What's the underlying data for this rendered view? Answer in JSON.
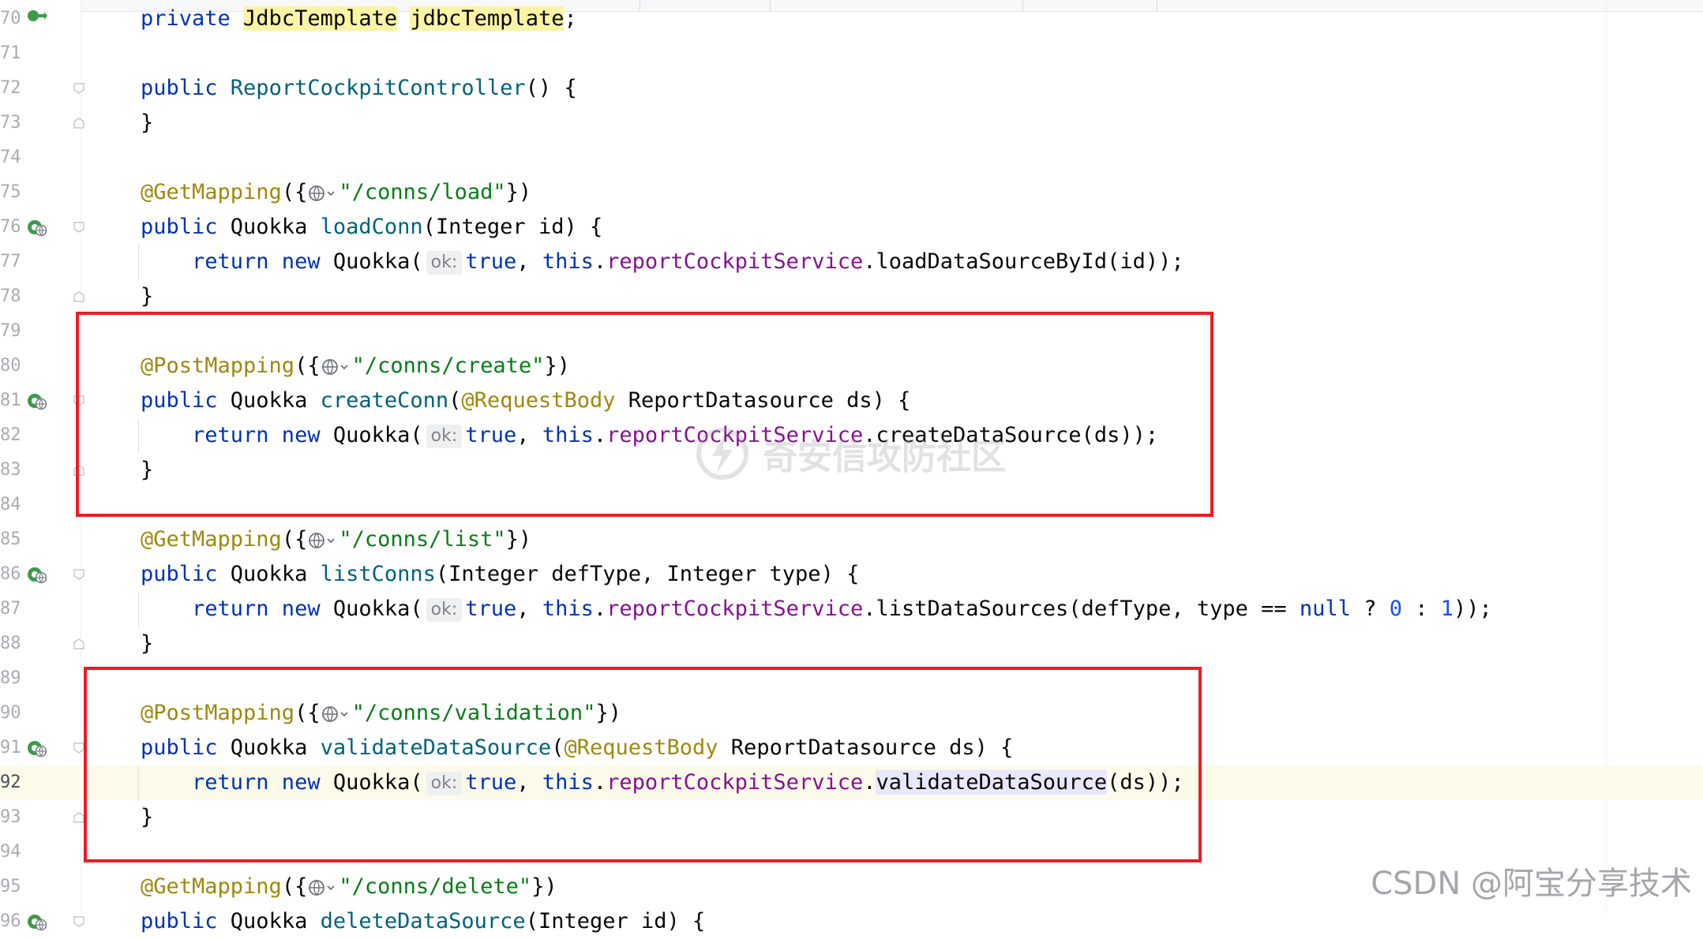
{
  "editor": {
    "lines": [
      {
        "num": "70",
        "icon": "override",
        "fold": "",
        "tokens": [
          {
            "t": "private ",
            "c": "kw"
          },
          {
            "t": "JdbcTemplate",
            "c": "hl"
          },
          {
            "t": " "
          },
          {
            "t": "jdbcTemplate",
            "c": "hl"
          },
          {
            "t": ";"
          }
        ]
      },
      {
        "num": "71",
        "icon": "",
        "fold": "",
        "tokens": []
      },
      {
        "num": "72",
        "icon": "",
        "fold": "open",
        "tokens": [
          {
            "t": "public ",
            "c": "kw"
          },
          {
            "t": "ReportCockpitController",
            "c": "fn"
          },
          {
            "t": "() {"
          }
        ]
      },
      {
        "num": "73",
        "icon": "",
        "fold": "close",
        "tokens": [
          {
            "t": "}"
          }
        ]
      },
      {
        "num": "74",
        "icon": "",
        "fold": "",
        "tokens": []
      },
      {
        "num": "75",
        "icon": "",
        "fold": "",
        "tokens": [
          {
            "t": "@GetMapping",
            "c": "ann"
          },
          {
            "t": "({"
          },
          {
            "globe": true
          },
          {
            "t": "\"/conns/load\"",
            "c": "str"
          },
          {
            "t": "})"
          }
        ]
      },
      {
        "num": "76",
        "icon": "bean",
        "fold": "open",
        "tokens": [
          {
            "t": "public ",
            "c": "kw"
          },
          {
            "t": "Quokka "
          },
          {
            "t": "loadConn",
            "c": "fn"
          },
          {
            "t": "(Integer id) {"
          }
        ]
      },
      {
        "num": "77",
        "icon": "",
        "fold": "",
        "guide": true,
        "tokens": [
          {
            "t": "    return new ",
            "c": "kw"
          },
          {
            "t": "Quokka("
          },
          {
            "hint": "ok:"
          },
          {
            "t": "true",
            "c": "kw"
          },
          {
            "t": ", "
          },
          {
            "t": "this",
            "c": "kw"
          },
          {
            "t": "."
          },
          {
            "t": "reportCockpitService",
            "c": "fld"
          },
          {
            "t": ".loadDataSourceById(id));"
          }
        ]
      },
      {
        "num": "78",
        "icon": "",
        "fold": "close",
        "tokens": [
          {
            "t": "}"
          }
        ]
      },
      {
        "num": "79",
        "icon": "",
        "fold": "",
        "tokens": []
      },
      {
        "num": "80",
        "icon": "",
        "fold": "",
        "tokens": [
          {
            "t": "@PostMapping",
            "c": "ann"
          },
          {
            "t": "({"
          },
          {
            "globe": true
          },
          {
            "t": "\"/conns/create\"",
            "c": "str"
          },
          {
            "t": "})"
          }
        ]
      },
      {
        "num": "81",
        "icon": "bean",
        "fold": "open",
        "tokens": [
          {
            "t": "public ",
            "c": "kw"
          },
          {
            "t": "Quokka "
          },
          {
            "t": "createConn",
            "c": "fn"
          },
          {
            "t": "("
          },
          {
            "t": "@RequestBody",
            "c": "ann"
          },
          {
            "t": " ReportDatasource ds) {"
          }
        ]
      },
      {
        "num": "82",
        "icon": "",
        "fold": "",
        "guide": true,
        "tokens": [
          {
            "t": "    return new ",
            "c": "kw"
          },
          {
            "t": "Quokka("
          },
          {
            "hint": "ok:"
          },
          {
            "t": "true",
            "c": "kw"
          },
          {
            "t": ", "
          },
          {
            "t": "this",
            "c": "kw"
          },
          {
            "t": "."
          },
          {
            "t": "reportCockpitService",
            "c": "fld"
          },
          {
            "t": ".createDataSource(ds));"
          }
        ]
      },
      {
        "num": "83",
        "icon": "",
        "fold": "close",
        "tokens": [
          {
            "t": "}"
          }
        ]
      },
      {
        "num": "84",
        "icon": "",
        "fold": "",
        "tokens": []
      },
      {
        "num": "85",
        "icon": "",
        "fold": "",
        "tokens": [
          {
            "t": "@GetMapping",
            "c": "ann"
          },
          {
            "t": "({"
          },
          {
            "globe": true
          },
          {
            "t": "\"/conns/list\"",
            "c": "str"
          },
          {
            "t": "})"
          }
        ]
      },
      {
        "num": "86",
        "icon": "bean",
        "fold": "open",
        "tokens": [
          {
            "t": "public ",
            "c": "kw"
          },
          {
            "t": "Quokka "
          },
          {
            "t": "listConns",
            "c": "fn"
          },
          {
            "t": "(Integer defType, Integer type) {"
          }
        ]
      },
      {
        "num": "87",
        "icon": "",
        "fold": "",
        "guide": true,
        "tokens": [
          {
            "t": "    return new ",
            "c": "kw"
          },
          {
            "t": "Quokka("
          },
          {
            "hint": "ok:"
          },
          {
            "t": "true",
            "c": "kw"
          },
          {
            "t": ", "
          },
          {
            "t": "this",
            "c": "kw"
          },
          {
            "t": "."
          },
          {
            "t": "reportCockpitService",
            "c": "fld"
          },
          {
            "t": ".listDataSources(defType, type == "
          },
          {
            "t": "null",
            "c": "kw"
          },
          {
            "t": " ? "
          },
          {
            "t": "0",
            "c": "num"
          },
          {
            "t": " : "
          },
          {
            "t": "1",
            "c": "num"
          },
          {
            "t": "));"
          }
        ]
      },
      {
        "num": "88",
        "icon": "",
        "fold": "close",
        "tokens": [
          {
            "t": "}"
          }
        ]
      },
      {
        "num": "89",
        "icon": "",
        "fold": "",
        "tokens": []
      },
      {
        "num": "90",
        "icon": "",
        "fold": "",
        "tokens": [
          {
            "t": "@PostMapping",
            "c": "ann"
          },
          {
            "t": "({"
          },
          {
            "globe": true
          },
          {
            "t": "\"/conns/validation\"",
            "c": "str"
          },
          {
            "t": "})"
          }
        ]
      },
      {
        "num": "91",
        "icon": "bean",
        "fold": "open",
        "tokens": [
          {
            "t": "public ",
            "c": "kw"
          },
          {
            "t": "Quokka "
          },
          {
            "t": "validateDataSource",
            "c": "fn"
          },
          {
            "t": "("
          },
          {
            "t": "@RequestBody",
            "c": "ann"
          },
          {
            "t": " ReportDatasource ds) {"
          }
        ]
      },
      {
        "num": "92",
        "icon": "",
        "fold": "",
        "guide": true,
        "current": true,
        "tokens": [
          {
            "t": "    return new ",
            "c": "kw"
          },
          {
            "t": "Quokka("
          },
          {
            "hint": "ok:"
          },
          {
            "t": "true",
            "c": "kw"
          },
          {
            "t": ", "
          },
          {
            "t": "this",
            "c": "kw"
          },
          {
            "t": "."
          },
          {
            "t": "reportCockpitService",
            "c": "fld"
          },
          {
            "t": "."
          },
          {
            "t": "validateDataSource",
            "c": "sel"
          },
          {
            "t": "(ds));"
          }
        ]
      },
      {
        "num": "93",
        "icon": "",
        "fold": "close",
        "tokens": [
          {
            "t": "}"
          }
        ]
      },
      {
        "num": "94",
        "icon": "",
        "fold": "",
        "tokens": []
      },
      {
        "num": "95",
        "icon": "",
        "fold": "",
        "tokens": [
          {
            "t": "@GetMapping",
            "c": "ann"
          },
          {
            "t": "({"
          },
          {
            "globe": true
          },
          {
            "t": "\"/conns/delete\"",
            "c": "str"
          },
          {
            "t": "})"
          }
        ]
      },
      {
        "num": "96",
        "icon": "bean",
        "fold": "open",
        "tokens": [
          {
            "t": "public ",
            "c": "kw"
          },
          {
            "t": "Quokka "
          },
          {
            "t": "deleteDataSource",
            "c": "fn"
          },
          {
            "t": "(Integer id) {"
          }
        ]
      }
    ]
  },
  "watermark": {
    "text": "奇安信攻防社区"
  },
  "csdn_watermark": {
    "text": "CSDN @阿宝分享技术"
  },
  "colors": {
    "keyword": "#0033b3",
    "annotation": "#9e880d",
    "string": "#067d17",
    "method": "#00627a",
    "field": "#871094",
    "number": "#1750eb",
    "highlight_box": "#ec1c24"
  }
}
